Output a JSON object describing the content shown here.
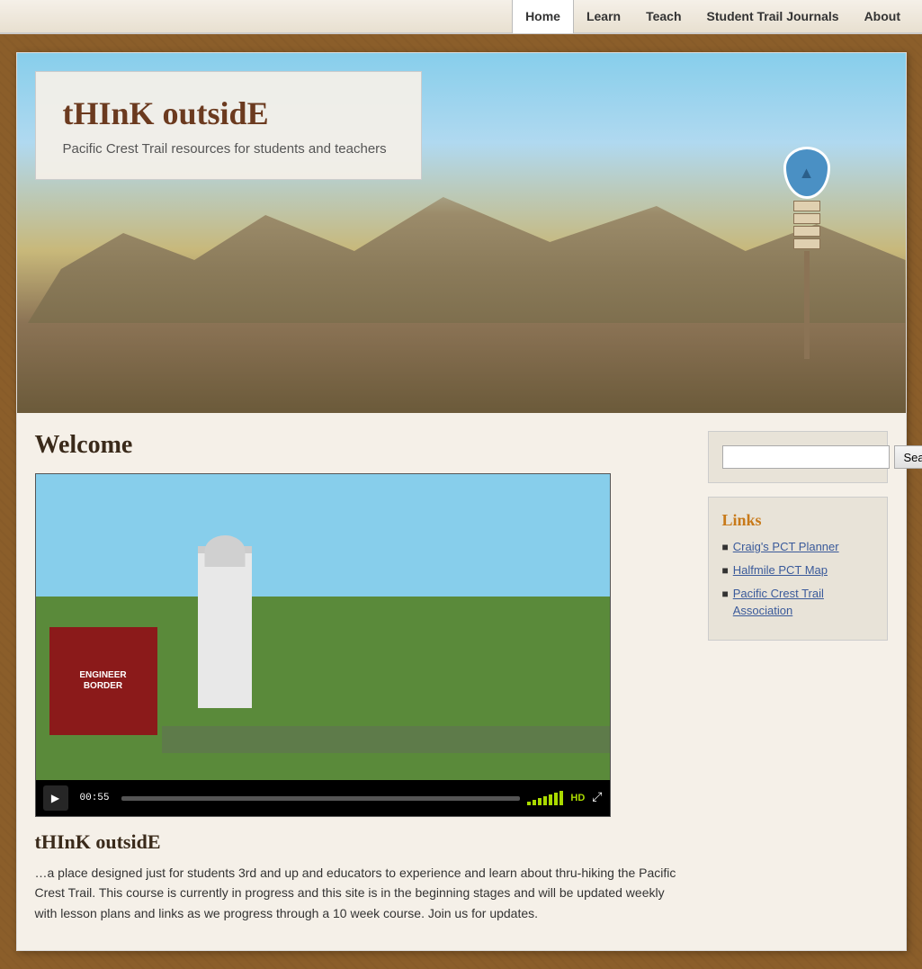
{
  "nav": {
    "home_label": "Home",
    "learn_label": "Learn",
    "teach_label": "Teach",
    "journals_label": "Student Trail Journals",
    "about_label": "About"
  },
  "header": {
    "title": "tHInK outsidE",
    "subtitle": "Pacific Crest Trail resources for students and teachers"
  },
  "main": {
    "welcome_heading": "Welcome",
    "video": {
      "time": "00:55"
    },
    "think_outside_title": "tHInK outsidE",
    "think_outside_text": "…a place designed just for students 3rd and up and educators to experience and learn about thru-hiking the Pacific Crest Trail. This course is currently in progress and this site is in the beginning stages and will be updated weekly with lesson plans and links as we progress through a 10 week course. Join us for updates."
  },
  "sidebar": {
    "search_placeholder": "",
    "search_button_label": "Search",
    "links_title": "Links",
    "links": [
      {
        "label": "Craig's PCT Planner",
        "url": "#"
      },
      {
        "label": "Halfmile PCT Map",
        "url": "#"
      },
      {
        "label": "Pacific Crest Trail Association",
        "url": "#"
      }
    ]
  }
}
